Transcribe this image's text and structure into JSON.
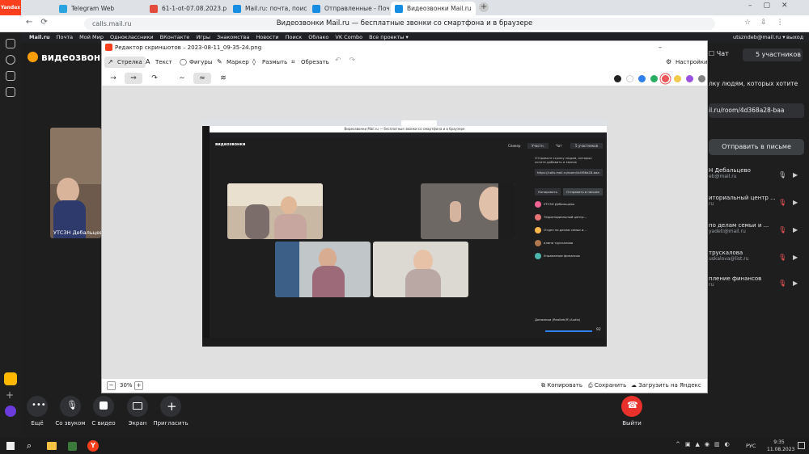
{
  "browser": {
    "yandex_label": "Yandex",
    "tabs": [
      {
        "label": "Telegram Web",
        "color": "#2aa3df"
      },
      {
        "label": "61-1-ot-07.08.2023.pdf",
        "color": "#e34b3c"
      },
      {
        "label": "Mail.ru: почта, поиск в ин",
        "color": "#168de2"
      },
      {
        "label": "Отправленные - Почта M",
        "color": "#168de2"
      },
      {
        "label": "Видеозвонки Mail.ru",
        "color": "#168de2"
      }
    ],
    "url": "calls.mail.ru",
    "page_title": "Видеозвонки Mail.ru — бесплатные звонки со смартфона и в браузере"
  },
  "mailbar": {
    "items": [
      "Mail.ru",
      "Почта",
      "Мой Мир",
      "Одноклассники",
      "ВКонтакте",
      "Игры",
      "Знакомства",
      "Новости",
      "Поиск",
      "Облако",
      "VK Combo",
      "Все проекты ▾"
    ],
    "user": "utszndeb@mail.ru ▾",
    "logout": "выход"
  },
  "call": {
    "logo": "видеозвонки",
    "left_participant": "УТСЗН Дебальцево",
    "chat_label": "Чат",
    "participants_label": "5 участников",
    "invite_hint": "лку людям, которых хотите",
    "link_text": "il.ru/room/4d368a28-baa",
    "send_email": "Отправить в письме",
    "participants": [
      {
        "name": "Н Дебальцево",
        "sub": "eb@mail.ru"
      },
      {
        "name": "иториальный центр ...",
        "sub": "ru"
      },
      {
        "name": "по делам семьи и ...",
        "sub": "yadeti@mail.ru"
      },
      {
        "name": "трускалова",
        "sub": "uskalova@list.ru"
      },
      {
        "name": "пление финансов",
        "sub": "ru"
      }
    ],
    "controls": [
      {
        "label": "Ещё",
        "icon": "more-icon"
      },
      {
        "label": "Со звуком",
        "icon": "microphone-icon"
      },
      {
        "label": "С видео",
        "icon": "camera-icon"
      },
      {
        "label": "Экран",
        "icon": "screen-share-icon"
      },
      {
        "label": "Пригласить",
        "icon": "plus-icon"
      },
      {
        "label": "Выйти",
        "icon": "hangup-icon"
      }
    ]
  },
  "editor": {
    "title": "Редактор скриншотов – 2023-08-11_09-35-24.png",
    "tools": [
      "Стрелка",
      "Текст",
      "Фигуры",
      "Маркер",
      "Размыть",
      "Обрезать"
    ],
    "settings": "Настройки",
    "colors": [
      "#222222",
      "#ffffff",
      "#2f80ed",
      "#27ae60",
      "#eb5757",
      "#f2994a",
      "#9b51e0",
      "#828282"
    ],
    "zoom": "30%",
    "copy": "Копировать",
    "save": "Сохранить",
    "upload": "Загрузить на Яндекс Диск"
  },
  "inner": {
    "page_title": "Видеозвонки Mail.ru — бесплатные звонки со смартфона и в браузере",
    "logo": "видеозвонки",
    "screen_btn": "Спикер",
    "parts_btn": "Участн.",
    "chat_btn": "Чат",
    "all_btn": "5 участников",
    "hint": "Отправьте ссылку людям, которых хотите добавить в звонок",
    "link": "https://calls.mail.ru/room/4d368a28-baa",
    "copy_btn": "Копировать",
    "send_btn": "Отправить в письме",
    "people": [
      "УТСЗН Дебальцево",
      "Территориальный центр...",
      "Отдел по делам семьи и...",
      "алина трускалова",
      "Управление финансов"
    ],
    "audio": "Динамики (Realtek(R) Audio)",
    "volume": "92"
  },
  "taskbar": {
    "lang": "РУС",
    "time": "9:35",
    "date": "11.08.2023"
  }
}
